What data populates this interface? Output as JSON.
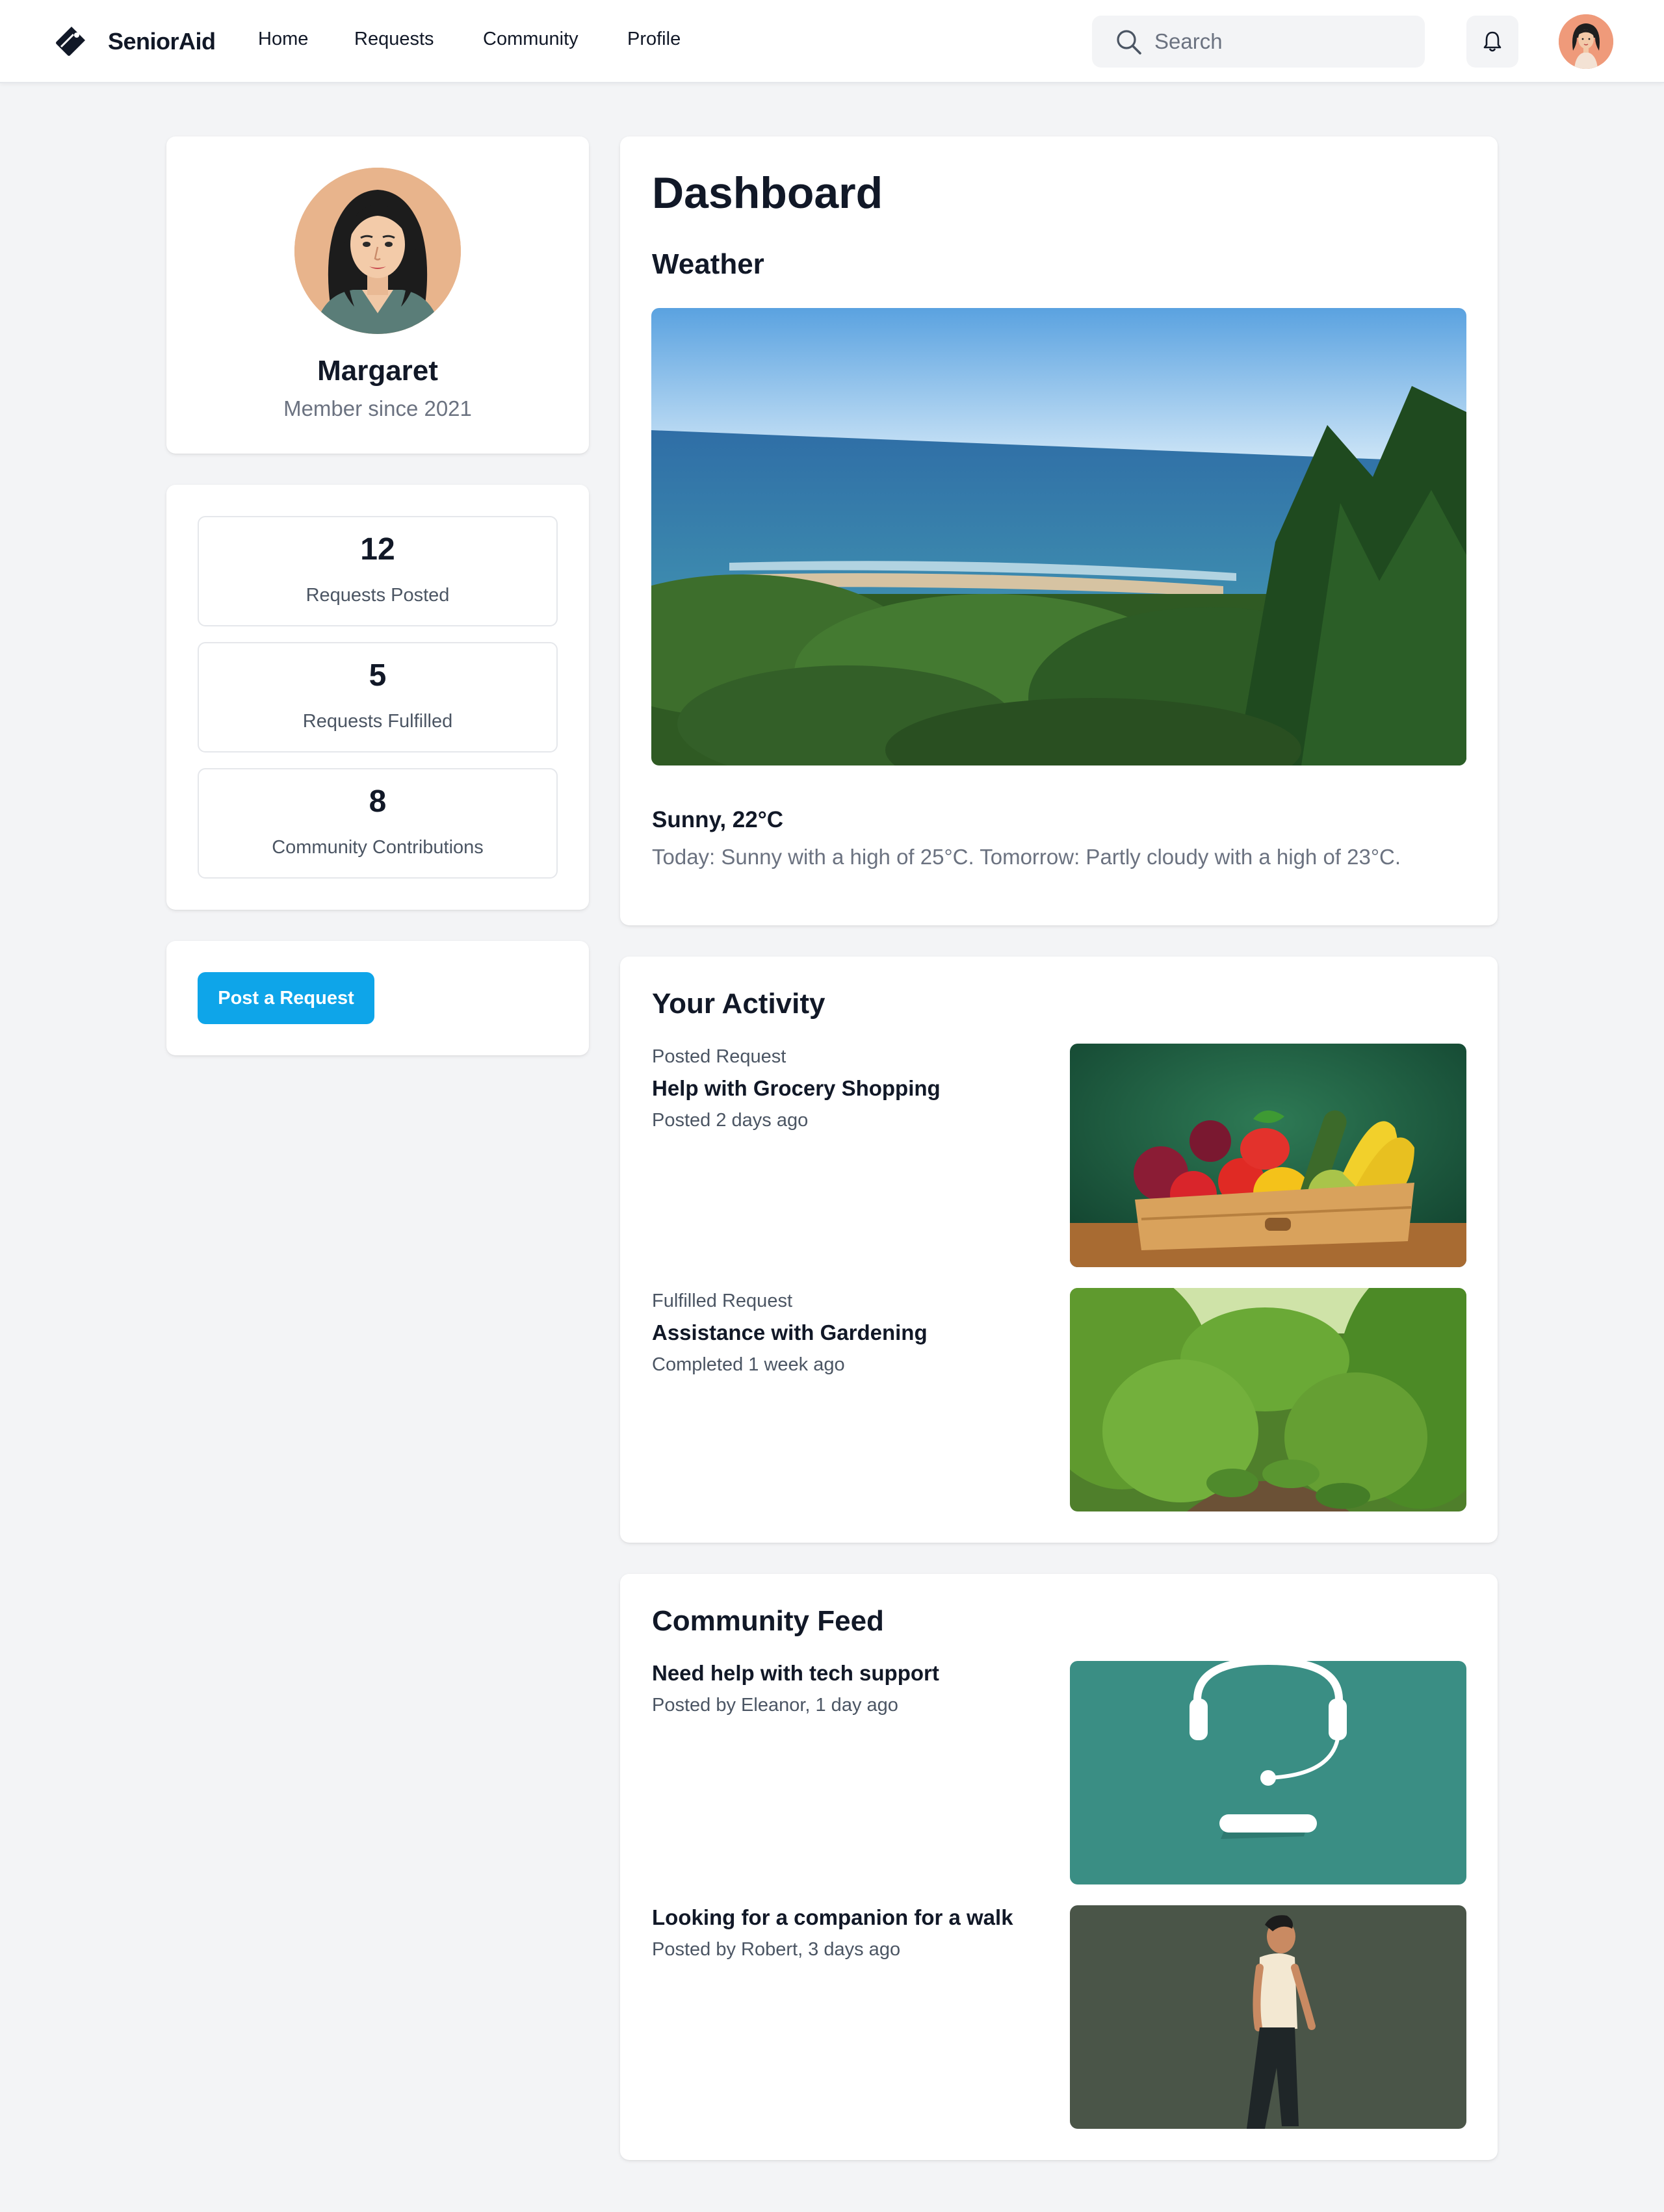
{
  "app": {
    "brand": "SeniorAid",
    "colors": {
      "accent": "#0ea5e9",
      "background": "#f3f4f6",
      "card": "#ffffff",
      "text": "#111827",
      "muted": "#6b7280"
    }
  },
  "nav": {
    "links": [
      "Home",
      "Requests",
      "Community",
      "Profile"
    ],
    "search_placeholder": "Search",
    "icons": {
      "logo": "tag-icon",
      "search": "search-icon",
      "notifications": "bell-icon"
    }
  },
  "profile": {
    "name": "Margaret",
    "member_since": "Member since 2021"
  },
  "stats": [
    {
      "value": "12",
      "label": "Requests Posted"
    },
    {
      "value": "5",
      "label": "Requests Fulfilled"
    },
    {
      "value": "8",
      "label": "Community Contributions"
    }
  ],
  "actions": {
    "post_request": "Post a Request"
  },
  "dashboard": {
    "title": "Dashboard",
    "weather": {
      "title": "Weather",
      "condition": "Sunny, 22°C",
      "forecast": "Today: Sunny with a high of 25°C. Tomorrow: Partly cloudy with a high of 23°C."
    }
  },
  "activity": {
    "title": "Your Activity",
    "items": [
      {
        "type": "Posted Request",
        "title": "Help with Grocery Shopping",
        "meta": "Posted 2 days ago"
      },
      {
        "type": "Fulfilled Request",
        "title": "Assistance with Gardening",
        "meta": "Completed 1 week ago"
      }
    ]
  },
  "feed": {
    "title": "Community Feed",
    "items": [
      {
        "title": "Need help with tech support",
        "meta": "Posted by Eleanor, 1 day ago"
      },
      {
        "title": "Looking for a companion for a walk",
        "meta": "Posted by Robert, 3 days ago"
      }
    ]
  }
}
